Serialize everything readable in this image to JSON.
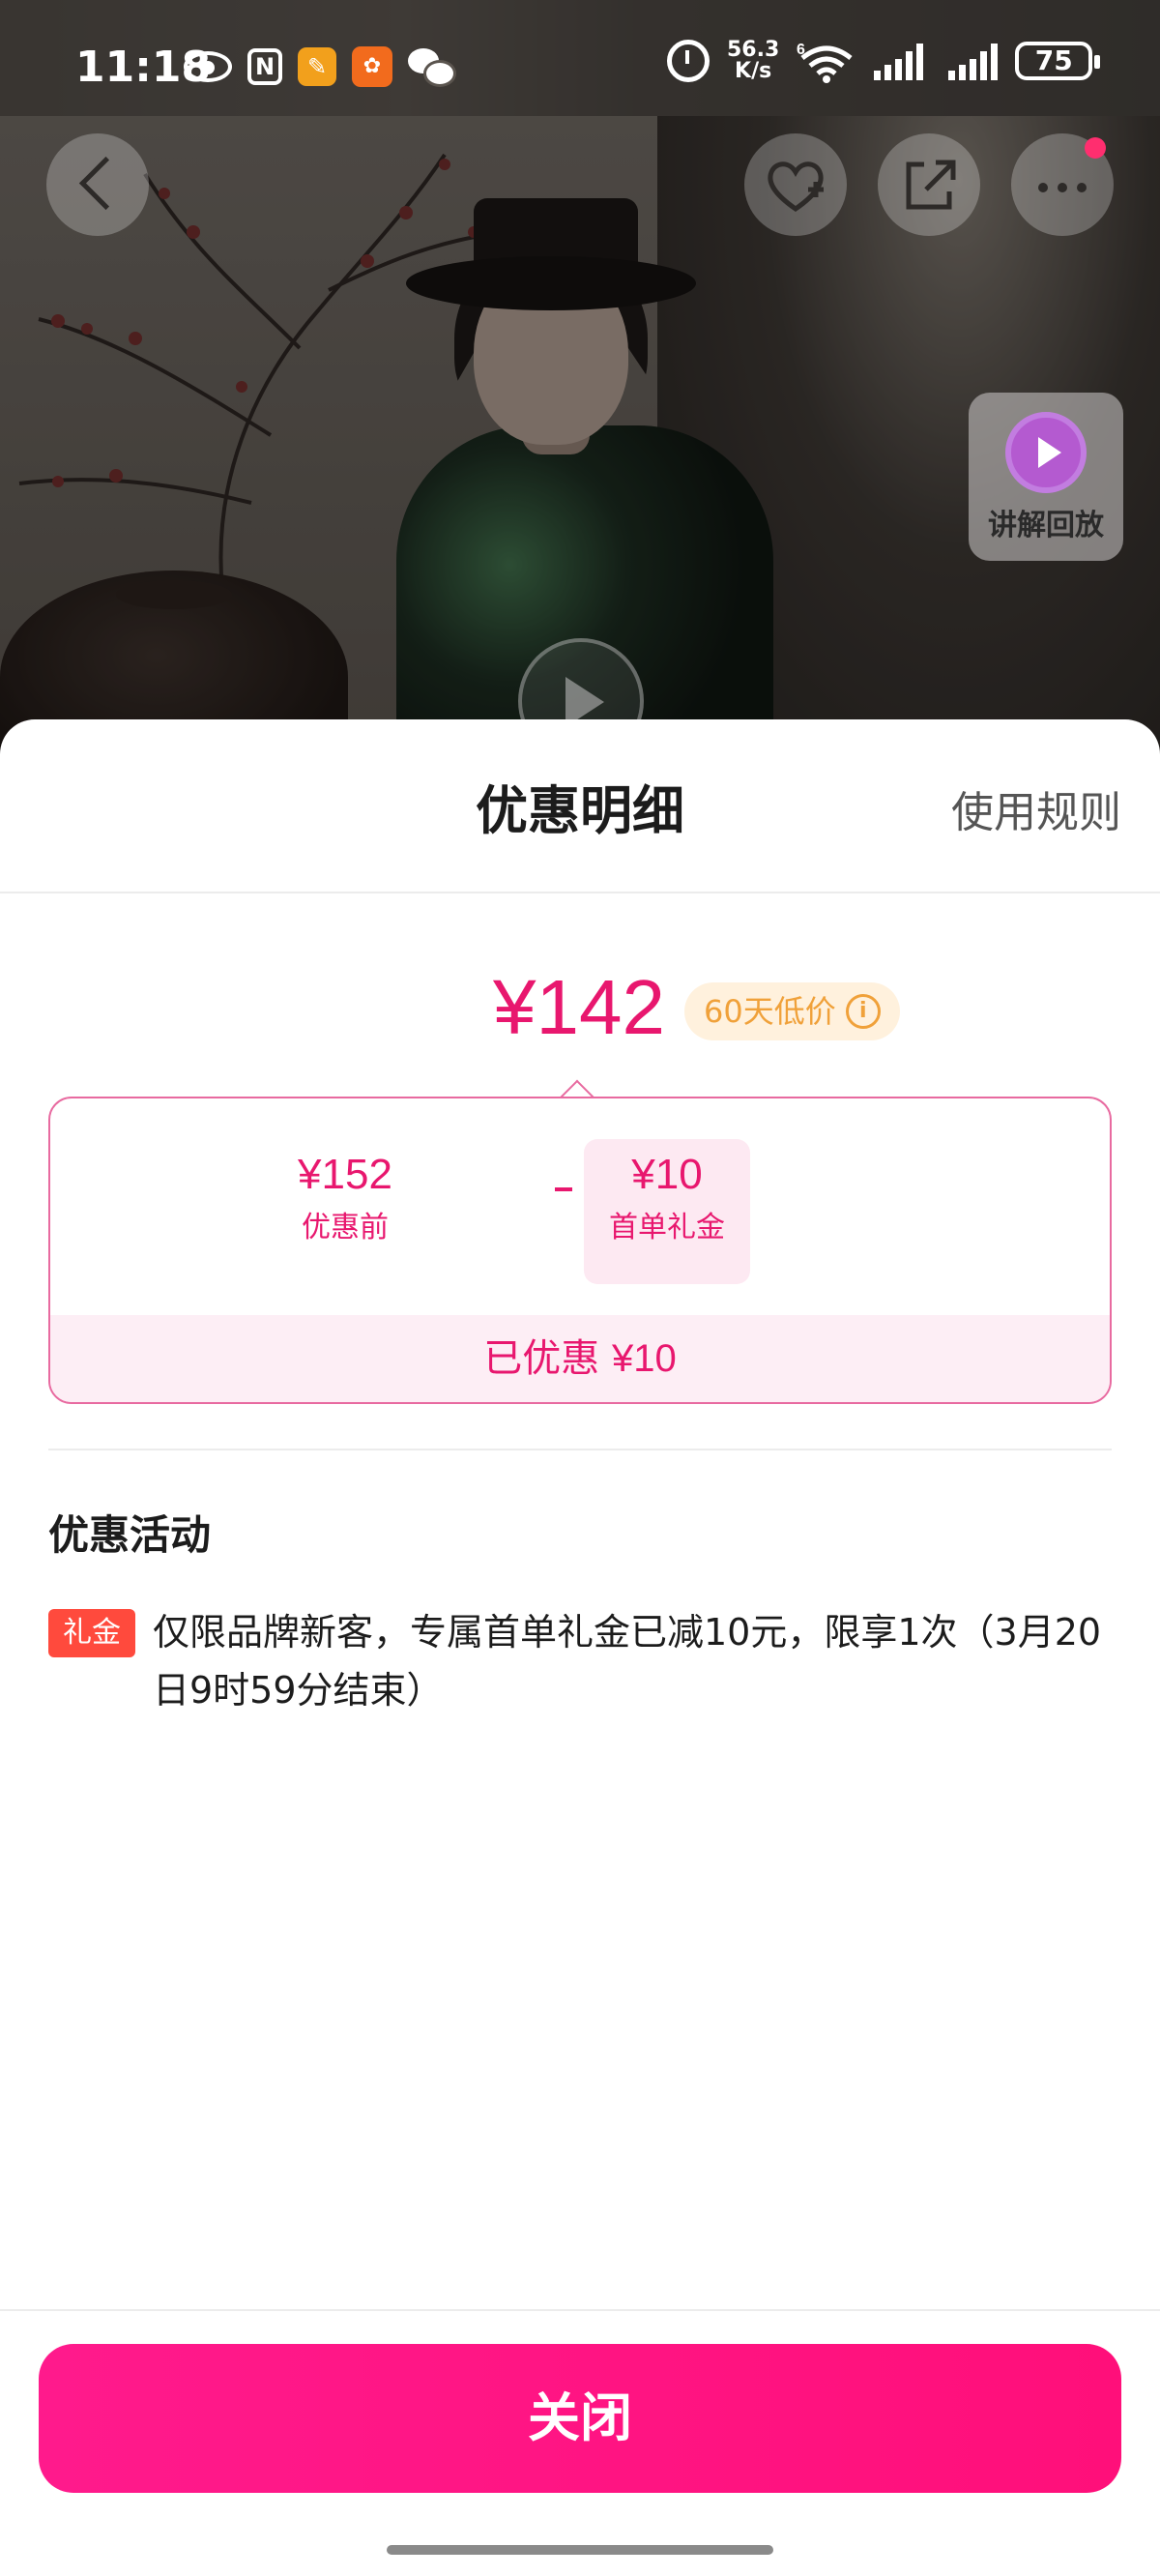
{
  "status_bar": {
    "time": "11:18",
    "network_speed_value": "56.3",
    "network_speed_unit": "K/s",
    "wifi_generation": "6",
    "battery": "75",
    "icons": [
      "eye-icon",
      "nfc-icon",
      "app-notification-icon",
      "app-notification-icon",
      "wechat-icon",
      "alarm-icon",
      "wifi-icon",
      "signal-icon",
      "signal-icon",
      "battery-icon"
    ]
  },
  "hero": {
    "replay_label": "讲解回放",
    "icons": [
      "back-icon",
      "favorite-add-icon",
      "share-icon",
      "more-icon",
      "replay-icon",
      "play-icon"
    ]
  },
  "sheet": {
    "title": "优惠明细",
    "rules_link": "使用规则",
    "final_price": "¥142",
    "low_price_badge": "60天低价",
    "low_price_info_icon": "i",
    "breakdown": {
      "original_amount": "¥152",
      "original_label": "优惠前",
      "coupon_amount": "¥10",
      "coupon_label": "首单礼金",
      "saved_label": "已优惠",
      "saved_amount": "¥10"
    },
    "section_title": "优惠活动",
    "promo": {
      "tag": "礼金",
      "text": "仅限品牌新客，专属首单礼金已减10元，限享1次（3月20日9时59分结束）"
    },
    "close_button": "关闭"
  },
  "colors": {
    "accent": "#e8176e",
    "button": "#ff1a8c",
    "promo_tag": "#ff4a3d",
    "badge_text": "#f0a13a"
  }
}
